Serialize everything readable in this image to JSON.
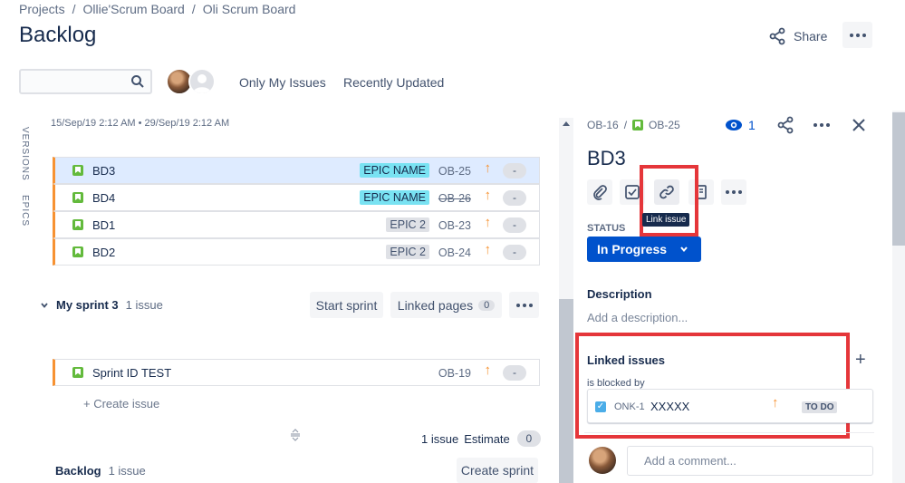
{
  "breadcrumb": {
    "items": [
      "Projects",
      "Ollie'Scrum Board",
      "Oli Scrum Board"
    ],
    "sep": "/"
  },
  "page_title": "Backlog",
  "header": {
    "share_label": "Share"
  },
  "search": {
    "placeholder": ""
  },
  "filters": {
    "only_my_issues": "Only My Issues",
    "recently_updated": "Recently Updated"
  },
  "side_tabs": {
    "versions": "VERSIONS",
    "epics": "EPICS"
  },
  "sprint_dates": "15/Sep/19 2:12 AM • 29/Sep/19 2:12 AM",
  "sprint_issues": [
    {
      "summary": "BD3",
      "epic": "EPIC NAME",
      "key": "OB-25",
      "estimate": "-"
    },
    {
      "summary": "BD4",
      "epic": "EPIC NAME",
      "key": "OB-26",
      "estimate": "-"
    },
    {
      "summary": "BD1",
      "epic": "EPIC 2",
      "key": "OB-23",
      "estimate": "-"
    },
    {
      "summary": "BD2",
      "epic": "EPIC 2",
      "key": "OB-24",
      "estimate": "-"
    }
  ],
  "my_sprint": {
    "name": "My sprint 3",
    "count": "1 issue",
    "start_label": "Start sprint",
    "linked_pages_label": "Linked pages",
    "linked_pages_count": "0",
    "issue": {
      "summary": "Sprint ID TEST",
      "key": "OB-19",
      "estimate": "-"
    },
    "create_issue": "+ Create issue",
    "footer_count": "1 issue",
    "estimate_label": "Estimate",
    "estimate_value": "0"
  },
  "backlog": {
    "name": "Backlog",
    "count": "1 issue",
    "create_sprint": "Create sprint"
  },
  "detail": {
    "parent_key": "OB-16",
    "key": "OB-25",
    "watch_count": "1",
    "title": "BD3",
    "tooltip": "Link issue",
    "status_label": "STATUS",
    "status_value": "In Progress",
    "description_label": "Description",
    "description_placeholder": "Add a description...",
    "linked_issues_label": "Linked issues",
    "link_type": "is blocked by",
    "linked_issue": {
      "key": "ONK-1",
      "summary": "XXXXX",
      "status": "TO DO"
    },
    "comment_placeholder": "Add a comment..."
  },
  "colors": {
    "accent": "#0052cc",
    "highlight_box": "#e5363a",
    "story": "#63ba3c",
    "priority": "#f79232",
    "epic_cyan": "#79e2f2"
  }
}
